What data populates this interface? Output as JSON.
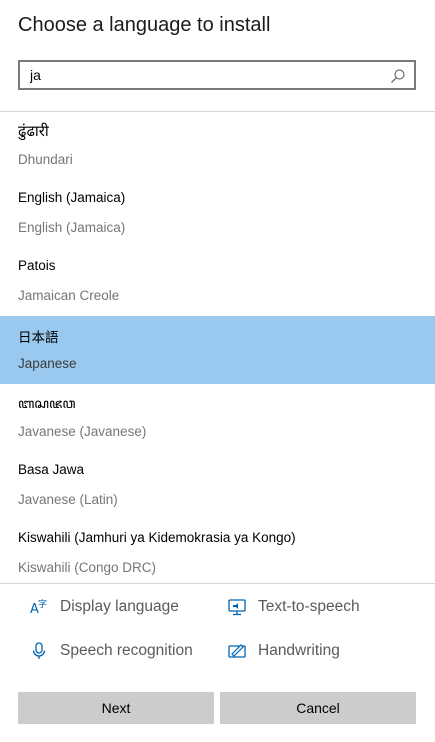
{
  "dialog": {
    "title": "Choose a language to install"
  },
  "search": {
    "value": "ja",
    "icon": "search-icon"
  },
  "languages": [
    {
      "native": "ढुंढारी",
      "english": "Dhundari",
      "selected": false
    },
    {
      "native": "English (Jamaica)",
      "english": "English (Jamaica)",
      "selected": false
    },
    {
      "native": "Patois",
      "english": "Jamaican Creole",
      "selected": false
    },
    {
      "native": "日本語",
      "english": "Japanese",
      "selected": true
    },
    {
      "native": "ꦧꦱꦗꦮ",
      "english": "Javanese (Javanese)",
      "selected": false
    },
    {
      "native": "Basa Jawa",
      "english": "Javanese (Latin)",
      "selected": false
    },
    {
      "native": "Kiswahili (Jamhuri ya Kidemokrasia ya Kongo)",
      "english": "Kiswahili (Congo DRC)",
      "selected": false
    }
  ],
  "features": {
    "display_language": {
      "label": "Display language",
      "icon": "display-language-icon"
    },
    "text_to_speech": {
      "label": "Text-to-speech",
      "icon": "text-to-speech-icon"
    },
    "speech_recognition": {
      "label": "Speech recognition",
      "icon": "microphone-icon"
    },
    "handwriting": {
      "label": "Handwriting",
      "icon": "handwriting-icon"
    }
  },
  "buttons": {
    "next": "Next",
    "cancel": "Cancel"
  },
  "colors": {
    "selection": "#99c9ef",
    "accent_icon": "#0063b1",
    "button_bg": "#cccccc"
  }
}
